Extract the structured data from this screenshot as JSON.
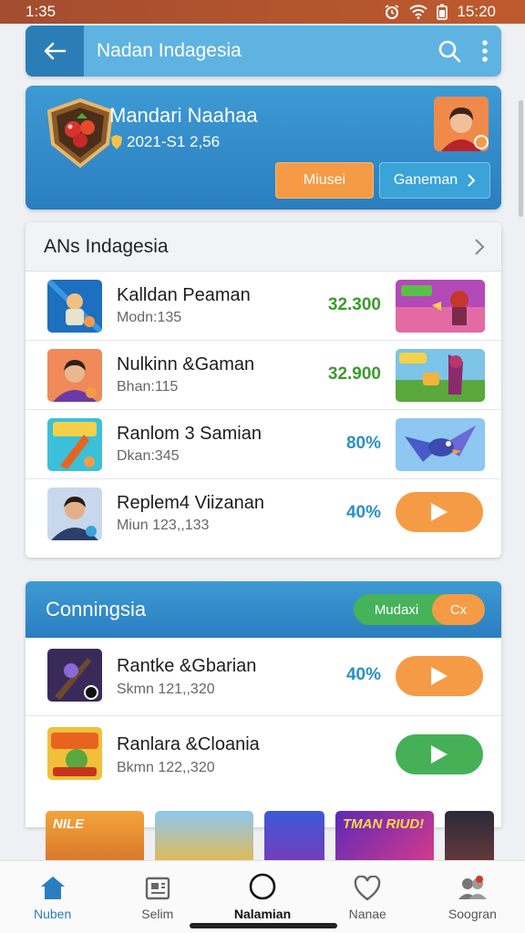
{
  "status_bar": {
    "time": "1:35",
    "right_time": "15:20"
  },
  "app_bar": {
    "title": "Nadan Indagesia"
  },
  "profile": {
    "name": "Mandari Naahaa",
    "sub": "2021-S1 2,56",
    "btn_primary": "Miusei",
    "btn_secondary": "Ganeman"
  },
  "section1": {
    "title": "ANs Indagesia",
    "items": [
      {
        "title": "Kalldan Peaman",
        "sub": "Modn:135",
        "value": "32.300",
        "value_color": "#3d9a2e"
      },
      {
        "title": "Nulkinn &Gaman",
        "sub": "Bhan:115",
        "value": "32.900",
        "value_color": "#3d9a2e"
      },
      {
        "title": "Ranlom 3 Samian",
        "sub": "Dkan:345",
        "value": "80%",
        "value_color": "#2a8fc8"
      },
      {
        "title": "Replem4 Viizanan",
        "sub": "Miun 123,,133",
        "value": "40%",
        "value_color": "#2a8fc8"
      }
    ]
  },
  "section2": {
    "title": "Conningsia",
    "toggle_left": "Mudaxi",
    "toggle_right": "Cx",
    "items": [
      {
        "title": "Rantke &Gbarian",
        "sub": "Skmn 121,,320",
        "value": "40%"
      },
      {
        "title": "Ranlara &Cloania",
        "sub": "Bkmn 122,,320",
        "value": ""
      }
    ]
  },
  "tiles": [
    "NILE",
    "",
    "",
    "TMAN RIUD!",
    ""
  ],
  "bottom_nav": [
    {
      "label": "Nuben",
      "icon": "home-icon"
    },
    {
      "label": "Selim",
      "icon": "media-icon"
    },
    {
      "label": "Nalamian",
      "icon": "compass-icon"
    },
    {
      "label": "Nanae",
      "icon": "heart-icon"
    },
    {
      "label": "Soogran",
      "icon": "people-icon"
    }
  ],
  "colors": {
    "primary_blue": "#2a7ec0",
    "accent_orange": "#f59b45",
    "accent_green": "#45b056"
  }
}
